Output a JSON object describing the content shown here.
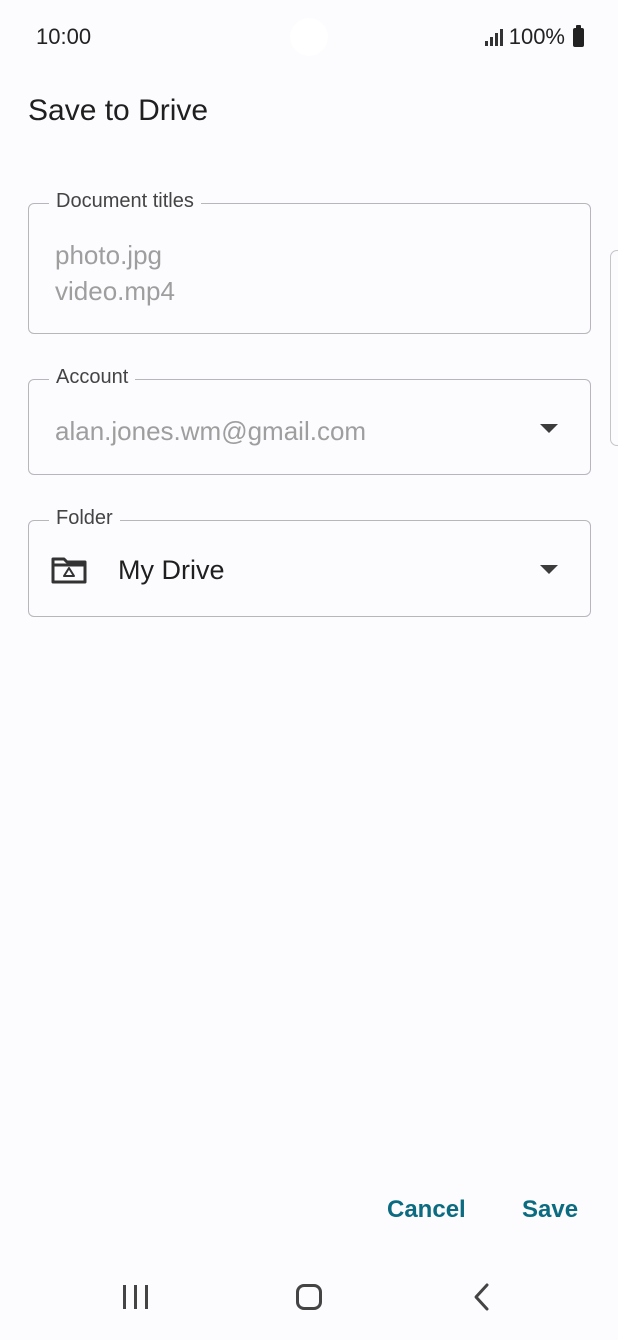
{
  "status_bar": {
    "time": "10:00",
    "battery": "100%"
  },
  "page": {
    "title": "Save to Drive"
  },
  "document_titles": {
    "label": "Document titles",
    "values": [
      "photo.jpg",
      "video.mp4"
    ]
  },
  "account": {
    "label": "Account",
    "value": "alan.jones.wm@gmail.com"
  },
  "folder": {
    "label": "Folder",
    "value": "My Drive"
  },
  "actions": {
    "cancel": "Cancel",
    "save": "Save"
  },
  "colors": {
    "accent": "#0b6b80",
    "background": "#fcfbfe",
    "outline": "#b8b6bc"
  },
  "icons": {
    "signal": "signal-icon",
    "battery": "battery-icon",
    "folder": "drive-folder-icon",
    "dropdown": "dropdown-arrow-icon",
    "recents": "recents-icon",
    "home": "home-icon",
    "back": "back-icon"
  }
}
